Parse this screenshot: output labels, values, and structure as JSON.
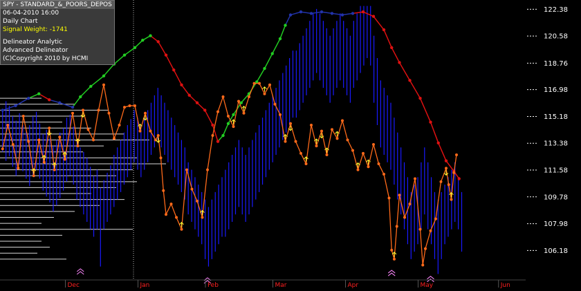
{
  "info_box": {
    "title": "SPY - STANDARD_&_POORS_DEPOS",
    "datetime": "06-04-2010  16:00",
    "chart_type": "Daily Chart",
    "signal_weight": "Signal Weight: -1741",
    "line1": "Delineator Analytic",
    "line2": "Advanced Delineator",
    "line3": "(C)Copyright 2010 by HCMI"
  },
  "colors": {
    "background": "#000000",
    "bars": "#1a1aff",
    "orange_line": "#ff6a1a",
    "trend_up": "#22cc22",
    "trend_down": "#dd1111",
    "trend_neutral": "#2233aa",
    "month_label": "#ff2020",
    "price_label": "#ffffff",
    "volume_profile": "#ffffff",
    "arrow_yellow": "#ffff33",
    "arrow_white": "#ffffff",
    "chevron": "#ff88ff"
  },
  "chart_data": {
    "type": "line",
    "symbol": "SPY",
    "y_ticks": [
      122.38,
      120.58,
      118.76,
      116.98,
      115.18,
      113.38,
      111.58,
      109.78,
      107.98,
      106.18
    ],
    "ylim": [
      104.2,
      123.0
    ],
    "x_months": [
      "Dec",
      "Jan",
      "Feb",
      "Mar",
      "Apr",
      "May",
      "Jun"
    ],
    "month_positions": [
      0.13,
      0.27,
      0.4,
      0.53,
      0.67,
      0.81,
      0.965
    ],
    "price_bars": [
      [
        112.8,
        115.6
      ],
      [
        112.2,
        116.2
      ],
      [
        112.5,
        115.9
      ],
      [
        111.8,
        115.2
      ],
      [
        111.2,
        114.9
      ],
      [
        112.0,
        115.4
      ],
      [
        111.5,
        114.6
      ],
      [
        111.0,
        114.2
      ],
      [
        110.5,
        114.6
      ],
      [
        111.2,
        115.2
      ],
      [
        111.6,
        115.5
      ],
      [
        111.0,
        114.7
      ],
      [
        110.2,
        114.0
      ],
      [
        109.8,
        114.3
      ],
      [
        109.4,
        113.7
      ],
      [
        108.8,
        113.2
      ],
      [
        109.2,
        113.6
      ],
      [
        109.7,
        114.1
      ],
      [
        110.2,
        114.4
      ],
      [
        110.8,
        115.1
      ],
      [
        111.2,
        115.3
      ],
      [
        110.6,
        114.5
      ],
      [
        109.6,
        113.6
      ],
      [
        109.1,
        113.1
      ],
      [
        108.6,
        112.8
      ],
      [
        108.1,
        112.4
      ],
      [
        107.6,
        111.8
      ],
      [
        107.1,
        111.2
      ],
      [
        107.6,
        111.6
      ],
      [
        105.1,
        110.4
      ],
      [
        107.6,
        110.9
      ],
      [
        108.1,
        111.4
      ],
      [
        108.6,
        111.9
      ],
      [
        109.1,
        112.6
      ],
      [
        109.6,
        113.1
      ],
      [
        110.1,
        113.6
      ],
      [
        110.6,
        114.1
      ],
      [
        111.1,
        114.6
      ],
      [
        111.6,
        115.0
      ],
      [
        112.1,
        115.6
      ],
      [
        111.6,
        115.1
      ],
      [
        111.1,
        114.6
      ],
      [
        111.6,
        115.1
      ],
      [
        112.1,
        115.6
      ],
      [
        112.6,
        116.1
      ],
      [
        113.1,
        116.6
      ],
      [
        113.6,
        117.1
      ],
      [
        113.1,
        116.6
      ],
      [
        112.6,
        116.1
      ],
      [
        112.1,
        115.6
      ],
      [
        111.6,
        115.1
      ],
      [
        111.1,
        114.6
      ],
      [
        110.6,
        114.1
      ],
      [
        110.1,
        113.6
      ],
      [
        109.6,
        113.1
      ],
      [
        108.6,
        112.1
      ],
      [
        108.1,
        111.6
      ],
      [
        107.6,
        111.1
      ],
      [
        107.1,
        110.6
      ],
      [
        106.6,
        110.1
      ],
      [
        105.6,
        109.6
      ],
      [
        105.1,
        109.1
      ],
      [
        105.6,
        109.6
      ],
      [
        106.1,
        110.1
      ],
      [
        106.6,
        110.6
      ],
      [
        107.1,
        111.1
      ],
      [
        107.1,
        111.6
      ],
      [
        107.6,
        112.1
      ],
      [
        108.1,
        112.6
      ],
      [
        108.6,
        113.1
      ],
      [
        109.1,
        113.6
      ],
      [
        108.6,
        113.1
      ],
      [
        108.1,
        112.6
      ],
      [
        108.6,
        113.1
      ],
      [
        109.1,
        113.6
      ],
      [
        109.6,
        114.1
      ],
      [
        110.1,
        114.6
      ],
      [
        110.6,
        115.1
      ],
      [
        111.1,
        115.6
      ],
      [
        111.6,
        116.1
      ],
      [
        112.1,
        116.6
      ],
      [
        112.6,
        117.1
      ],
      [
        113.1,
        117.6
      ],
      [
        113.6,
        118.1
      ],
      [
        114.1,
        118.6
      ],
      [
        114.6,
        119.1
      ],
      [
        115.1,
        119.6
      ],
      [
        115.1,
        119.6
      ],
      [
        115.6,
        120.1
      ],
      [
        116.1,
        120.6
      ],
      [
        116.6,
        121.1
      ],
      [
        117.1,
        121.6
      ],
      [
        117.6,
        122.1
      ],
      [
        118.1,
        122.4
      ],
      [
        117.6,
        122.1
      ],
      [
        117.1,
        121.6
      ],
      [
        116.6,
        121.1
      ],
      [
        116.1,
        120.6
      ],
      [
        116.6,
        121.1
      ],
      [
        117.1,
        121.6
      ],
      [
        117.6,
        122.1
      ],
      [
        117.1,
        121.6
      ],
      [
        116.6,
        121.1
      ],
      [
        116.1,
        120.6
      ],
      [
        117.1,
        121.6
      ],
      [
        117.6,
        122.1
      ],
      [
        118.1,
        122.6
      ],
      [
        118.6,
        122.6
      ],
      [
        119.1,
        122.6
      ],
      [
        118.6,
        122.6
      ],
      [
        116.1,
        120.6
      ],
      [
        114.6,
        119.1
      ],
      [
        113.1,
        117.6
      ],
      [
        112.6,
        117.1
      ],
      [
        112.1,
        116.6
      ],
      [
        111.6,
        116.1
      ],
      [
        110.6,
        115.1
      ],
      [
        109.6,
        114.1
      ],
      [
        108.6,
        113.1
      ],
      [
        107.6,
        112.1
      ],
      [
        106.6,
        111.1
      ],
      [
        105.6,
        110.1
      ],
      [
        106.1,
        110.6
      ],
      [
        106.6,
        111.1
      ],
      [
        107.6,
        112.1
      ],
      [
        108.6,
        113.1
      ],
      [
        107.6,
        112.1
      ],
      [
        106.6,
        111.1
      ],
      [
        105.6,
        110.1
      ],
      [
        104.6,
        109.6
      ],
      [
        105.6,
        110.1
      ],
      [
        106.6,
        110.6
      ],
      [
        107.1,
        111.1
      ],
      [
        107.6,
        111.6
      ],
      [
        108.1,
        112.1
      ],
      [
        107.6,
        111.1
      ],
      [
        106.1,
        110.1
      ]
    ],
    "trend_line": [
      [
        0.005,
        115.6,
        "n"
      ],
      [
        0.03,
        115.9,
        "n"
      ],
      [
        0.055,
        116.4,
        "n"
      ],
      [
        0.075,
        116.7,
        "u"
      ],
      [
        0.095,
        116.3,
        "d"
      ],
      [
        0.115,
        116.1,
        "n"
      ],
      [
        0.14,
        115.8,
        "n"
      ],
      [
        0.155,
        116.5,
        "u"
      ],
      [
        0.175,
        117.2,
        "u"
      ],
      [
        0.2,
        117.9,
        "u"
      ],
      [
        0.22,
        118.7,
        "u"
      ],
      [
        0.24,
        119.3,
        "u"
      ],
      [
        0.26,
        119.8,
        "u"
      ],
      [
        0.275,
        120.3,
        "u"
      ],
      [
        0.29,
        120.6,
        "u"
      ],
      [
        0.305,
        120.2,
        "d"
      ],
      [
        0.32,
        119.3,
        "d"
      ],
      [
        0.335,
        118.3,
        "d"
      ],
      [
        0.35,
        117.3,
        "d"
      ],
      [
        0.365,
        116.6,
        "d"
      ],
      [
        0.38,
        116.1,
        "d"
      ],
      [
        0.395,
        115.6,
        "d"
      ],
      [
        0.41,
        114.6,
        "d"
      ],
      [
        0.42,
        113.5,
        "d"
      ],
      [
        0.43,
        113.9,
        "u"
      ],
      [
        0.44,
        114.7,
        "u"
      ],
      [
        0.45,
        115.3,
        "u"
      ],
      [
        0.465,
        116.1,
        "u"
      ],
      [
        0.48,
        116.7,
        "u"
      ],
      [
        0.495,
        117.5,
        "u"
      ],
      [
        0.51,
        118.4,
        "u"
      ],
      [
        0.525,
        119.4,
        "u"
      ],
      [
        0.54,
        120.4,
        "u"
      ],
      [
        0.55,
        121.3,
        "u"
      ],
      [
        0.56,
        122.0,
        "n"
      ],
      [
        0.58,
        122.2,
        "n"
      ],
      [
        0.6,
        122.1,
        "n"
      ],
      [
        0.62,
        122.2,
        "n"
      ],
      [
        0.64,
        122.1,
        "n"
      ],
      [
        0.66,
        122.0,
        "n"
      ],
      [
        0.68,
        122.1,
        "n"
      ],
      [
        0.7,
        122.2,
        "d"
      ],
      [
        0.72,
        121.9,
        "d"
      ],
      [
        0.74,
        121.0,
        "d"
      ],
      [
        0.755,
        119.8,
        "d"
      ],
      [
        0.77,
        118.8,
        "d"
      ],
      [
        0.79,
        117.6,
        "d"
      ],
      [
        0.81,
        116.4,
        "d"
      ],
      [
        0.83,
        114.8,
        "d"
      ],
      [
        0.845,
        113.4,
        "d"
      ],
      [
        0.86,
        112.2,
        "d"
      ],
      [
        0.875,
        111.5,
        "d"
      ],
      [
        0.885,
        111.0,
        "d"
      ]
    ],
    "orange_line": [
      [
        0.005,
        113.0
      ],
      [
        0.015,
        114.6
      ],
      [
        0.025,
        113.3
      ],
      [
        0.035,
        111.7
      ],
      [
        0.045,
        115.2
      ],
      [
        0.055,
        113.5
      ],
      [
        0.065,
        111.2
      ],
      [
        0.075,
        113.6
      ],
      [
        0.085,
        112.1
      ],
      [
        0.095,
        114.4
      ],
      [
        0.105,
        111.6
      ],
      [
        0.115,
        113.8
      ],
      [
        0.125,
        112.3
      ],
      [
        0.14,
        115.4
      ],
      [
        0.15,
        113.2
      ],
      [
        0.16,
        115.6
      ],
      [
        0.17,
        114.3
      ],
      [
        0.18,
        113.6
      ],
      [
        0.19,
        115.6
      ],
      [
        0.2,
        117.3
      ],
      [
        0.21,
        115.4
      ],
      [
        0.22,
        113.7
      ],
      [
        0.23,
        114.6
      ],
      [
        0.24,
        115.8
      ],
      [
        0.25,
        115.9
      ],
      [
        0.26,
        115.9
      ],
      [
        0.27,
        114.2
      ],
      [
        0.28,
        115.4
      ],
      [
        0.29,
        114.2
      ],
      [
        0.3,
        113.6
      ],
      [
        0.305,
        113.9
      ],
      [
        0.31,
        112.4
      ],
      [
        0.315,
        110.2
      ],
      [
        0.32,
        108.6
      ],
      [
        0.33,
        109.3
      ],
      [
        0.34,
        108.4
      ],
      [
        0.35,
        107.6
      ],
      [
        0.36,
        111.6
      ],
      [
        0.37,
        110.3
      ],
      [
        0.38,
        109.5
      ],
      [
        0.39,
        108.4
      ],
      [
        0.4,
        111.6
      ],
      [
        0.41,
        113.9
      ],
      [
        0.42,
        115.5
      ],
      [
        0.43,
        116.5
      ],
      [
        0.44,
        115.2
      ],
      [
        0.45,
        114.5
      ],
      [
        0.46,
        116.2
      ],
      [
        0.47,
        115.4
      ],
      [
        0.48,
        116.5
      ],
      [
        0.49,
        117.4
      ],
      [
        0.5,
        117.4
      ],
      [
        0.51,
        116.7
      ],
      [
        0.52,
        117.3
      ],
      [
        0.53,
        116.0
      ],
      [
        0.54,
        115.3
      ],
      [
        0.55,
        113.5
      ],
      [
        0.56,
        114.7
      ],
      [
        0.57,
        113.5
      ],
      [
        0.58,
        112.7
      ],
      [
        0.59,
        112.0
      ],
      [
        0.6,
        114.6
      ],
      [
        0.61,
        113.2
      ],
      [
        0.62,
        114.2
      ],
      [
        0.63,
        112.6
      ],
      [
        0.64,
        114.3
      ],
      [
        0.65,
        113.7
      ],
      [
        0.66,
        114.9
      ],
      [
        0.67,
        113.6
      ],
      [
        0.68,
        112.9
      ],
      [
        0.69,
        111.6
      ],
      [
        0.7,
        112.7
      ],
      [
        0.71,
        111.8
      ],
      [
        0.72,
        113.3
      ],
      [
        0.73,
        112.0
      ],
      [
        0.74,
        111.3
      ],
      [
        0.75,
        109.7
      ],
      [
        0.755,
        106.2
      ],
      [
        0.76,
        105.6
      ],
      [
        0.765,
        107.8
      ],
      [
        0.77,
        109.9
      ],
      [
        0.78,
        108.4
      ],
      [
        0.79,
        109.3
      ],
      [
        0.8,
        111.0
      ],
      [
        0.81,
        107.6
      ],
      [
        0.815,
        105.2
      ],
      [
        0.82,
        106.3
      ],
      [
        0.83,
        107.5
      ],
      [
        0.84,
        108.3
      ],
      [
        0.85,
        110.8
      ],
      [
        0.86,
        111.7
      ],
      [
        0.865,
        110.6
      ],
      [
        0.87,
        109.6
      ],
      [
        0.875,
        111.4
      ],
      [
        0.88,
        112.6
      ]
    ],
    "volume_profile": [
      [
        116.4,
        0.1
      ],
      [
        116.0,
        0.18
      ],
      [
        115.6,
        0.26
      ],
      [
        115.2,
        0.2
      ],
      [
        114.8,
        0.15
      ],
      [
        114.4,
        0.22
      ],
      [
        114.0,
        0.3
      ],
      [
        113.6,
        0.36
      ],
      [
        113.2,
        0.25
      ],
      [
        112.8,
        0.2
      ],
      [
        112.4,
        0.33
      ],
      [
        112.0,
        0.4
      ],
      [
        111.6,
        0.32
      ],
      [
        111.2,
        0.28
      ],
      [
        110.8,
        0.33
      ],
      [
        110.4,
        0.28
      ],
      [
        110.0,
        0.22
      ],
      [
        109.6,
        0.3
      ],
      [
        109.2,
        0.24
      ],
      [
        108.8,
        0.18
      ],
      [
        108.4,
        0.13
      ],
      [
        108.0,
        0.1
      ],
      [
        107.6,
        0.32
      ],
      [
        107.2,
        0.15
      ],
      [
        106.8,
        0.1
      ],
      [
        106.4,
        0.12
      ],
      [
        106.0,
        0.09
      ],
      [
        105.6,
        0.16
      ]
    ]
  }
}
